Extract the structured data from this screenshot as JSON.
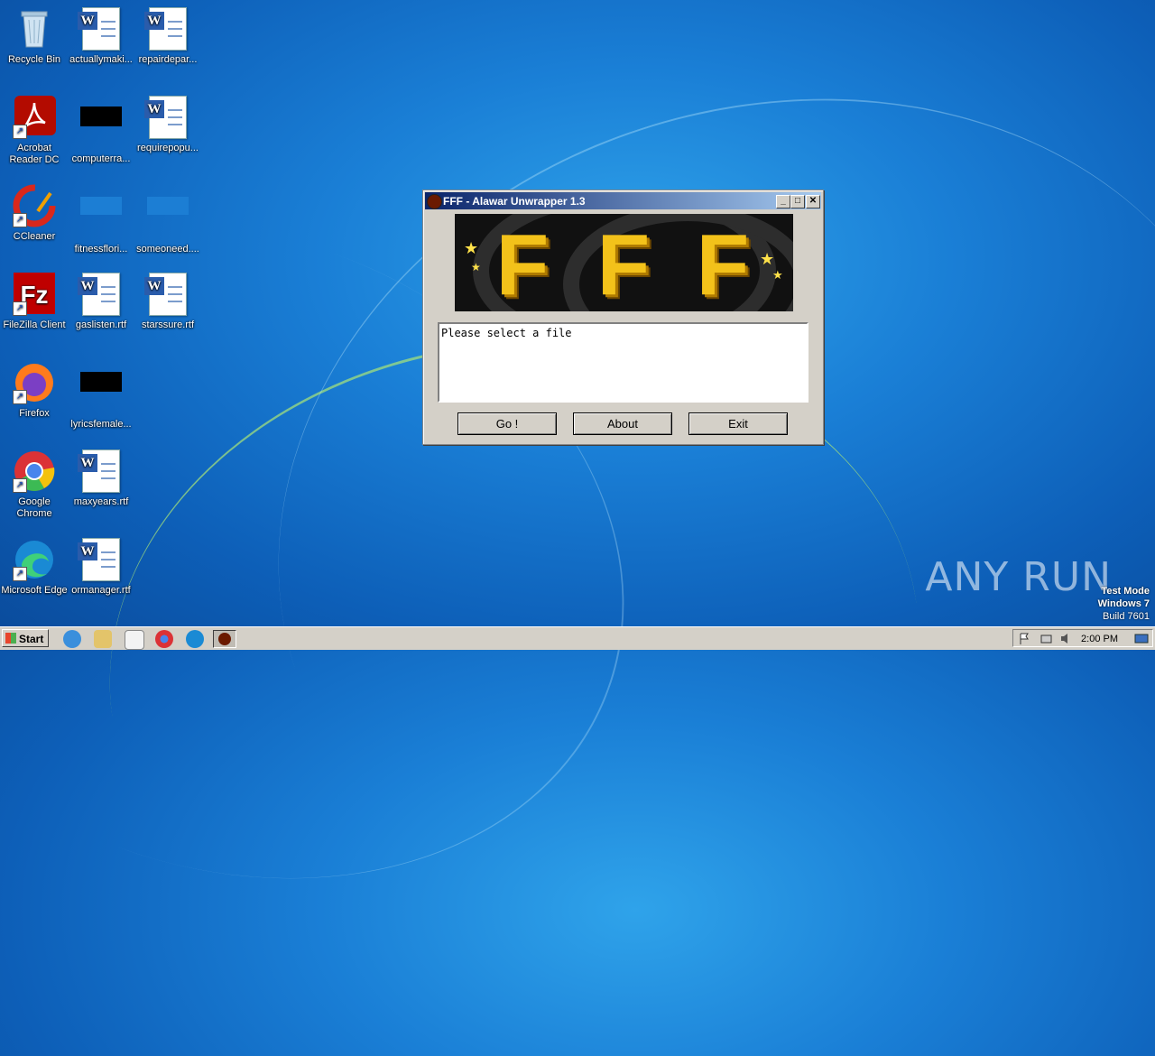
{
  "desktop": {
    "icons": [
      {
        "label": "Recycle Bin"
      },
      {
        "label": "actuallymaki..."
      },
      {
        "label": "repairdepar..."
      },
      {
        "label": "Acrobat Reader DC"
      },
      {
        "label": "computerra..."
      },
      {
        "label": "requirepopu..."
      },
      {
        "label": "CCleaner"
      },
      {
        "label": "fitnessflori..."
      },
      {
        "label": "someoneed...."
      },
      {
        "label": "FileZilla Client"
      },
      {
        "label": "gaslisten.rtf"
      },
      {
        "label": "starssure.rtf"
      },
      {
        "label": "Firefox"
      },
      {
        "label": "lyricsfemale..."
      },
      {
        "label": "Google Chrome"
      },
      {
        "label": "maxyears.rtf"
      },
      {
        "label": "Microsoft Edge"
      },
      {
        "label": "ormanager.rtf"
      }
    ]
  },
  "window": {
    "title": "FFF - Alawar Unwrapper 1.3",
    "status_text": "Please select a file",
    "buttons": {
      "go": "Go !",
      "about": "About",
      "exit": "Exit"
    }
  },
  "taskbar": {
    "start_label": "Start",
    "clock": "2:00 PM"
  },
  "watermark": "ANY RUN",
  "test_mode": {
    "line1": "Test Mode",
    "line2": "Windows 7",
    "line3": "Build 7601"
  }
}
